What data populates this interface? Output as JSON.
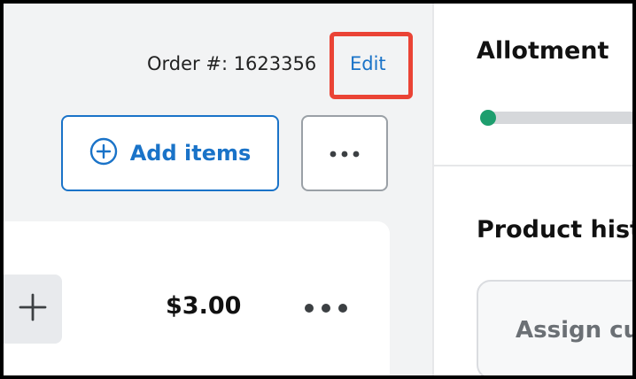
{
  "order": {
    "label": "Order #: 1623356",
    "edit_label": "Edit"
  },
  "toolbar": {
    "add_items_label": "Add items"
  },
  "line_item": {
    "price": "$3.00"
  },
  "allotment": {
    "title": "Allotment",
    "progress_fraction": 0.0
  },
  "product_history": {
    "title": "Product hist",
    "assign_label": "Assign cu"
  },
  "colors": {
    "accent": "#1a73c8",
    "highlight": "#ea4335",
    "progress": "#1e9e6e"
  },
  "icons": [
    "plus-circle-icon",
    "more-horizontal-icon",
    "plus-icon"
  ]
}
